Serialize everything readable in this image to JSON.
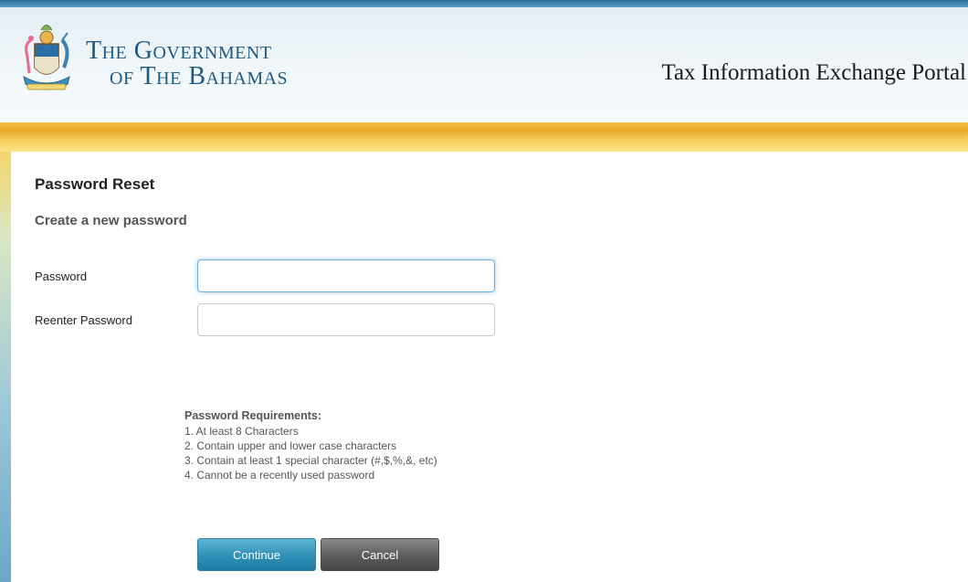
{
  "header": {
    "gov_title_line1": "The Government",
    "gov_title_line2": "of The Bahamas",
    "portal_title": "Tax Information Exchange Portal",
    "crest_icon": "bahamas-coat-of-arms-icon"
  },
  "form": {
    "title": "Password Reset",
    "subtitle": "Create a new password",
    "password_label": "Password",
    "password_value": "",
    "reenter_label": "Reenter Password",
    "reenter_value": ""
  },
  "requirements": {
    "title": "Password Requirements:",
    "items": [
      "1.  At least 8 Characters",
      "2.  Contain upper and lower case characters",
      "3.  Contain at least 1 special character (#,$,%,&, etc)",
      "4.  Cannot be a recently used password"
    ]
  },
  "buttons": {
    "continue_label": "Continue",
    "cancel_label": "Cancel"
  },
  "colors": {
    "brand_blue": "#1c5b86",
    "accent_gold": "#e8a726",
    "continue_blue": "#2f8fb6",
    "cancel_gray": "#5b5b5b",
    "focus_blue": "#66afe9"
  }
}
